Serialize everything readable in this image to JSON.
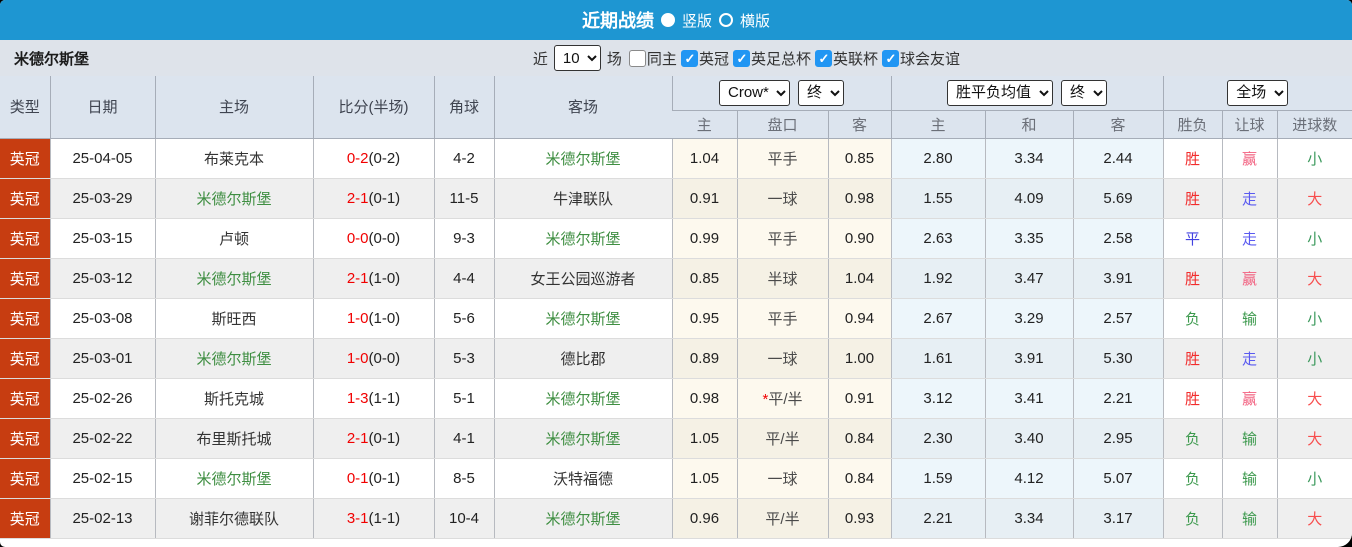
{
  "page": {
    "title": "近期战绩",
    "layout_options": [
      {
        "label": "竖版",
        "selected": true
      },
      {
        "label": "横版",
        "selected": false
      }
    ]
  },
  "filter": {
    "team": "米德尔斯堡",
    "recent_prefix": "近",
    "recent_count": "10",
    "recent_suffix": "场",
    "same_home_label": "同主",
    "same_home_checked": false,
    "competitions": [
      {
        "label": "英冠",
        "checked": true
      },
      {
        "label": "英足总杯",
        "checked": true
      },
      {
        "label": "英联杯",
        "checked": true
      },
      {
        "label": "球会友谊",
        "checked": true
      }
    ]
  },
  "header": {
    "odds_source_select": "Crow*",
    "odds_time_select": "终",
    "avg_type_select": "胜平负均值",
    "avg_time_select": "终",
    "scope_select": "全场"
  },
  "table": {
    "columns": [
      "类型",
      "日期",
      "主场",
      "比分(半场)",
      "角球",
      "客场"
    ],
    "sub_columns": [
      "主",
      "盘口",
      "客",
      "主",
      "和",
      "客",
      "胜负",
      "让球",
      "进球数"
    ],
    "rows": [
      {
        "league": "英冠",
        "date": "25-04-05",
        "home": "布莱克本",
        "score": "0-2",
        "half": "(0-2)",
        "corners": "4-2",
        "away": "米德尔斯堡",
        "odds_home": "1.04",
        "handicap": "平手",
        "star": false,
        "odds_away": "0.85",
        "avg_home": "2.80",
        "avg_draw": "3.34",
        "avg_away": "2.44",
        "result": "胜",
        "handicap_result": "赢",
        "goals": "小"
      },
      {
        "league": "英冠",
        "date": "25-03-29",
        "home": "米德尔斯堡",
        "score": "2-1",
        "half": "(0-1)",
        "corners": "11-5",
        "away": "牛津联队",
        "odds_home": "0.91",
        "handicap": "一球",
        "star": false,
        "odds_away": "0.98",
        "avg_home": "1.55",
        "avg_draw": "4.09",
        "avg_away": "5.69",
        "result": "胜",
        "handicap_result": "走",
        "goals": "大"
      },
      {
        "league": "英冠",
        "date": "25-03-15",
        "home": "卢顿",
        "score": "0-0",
        "half": "(0-0)",
        "corners": "9-3",
        "away": "米德尔斯堡",
        "odds_home": "0.99",
        "handicap": "平手",
        "star": false,
        "odds_away": "0.90",
        "avg_home": "2.63",
        "avg_draw": "3.35",
        "avg_away": "2.58",
        "result": "平",
        "handicap_result": "走",
        "goals": "小"
      },
      {
        "league": "英冠",
        "date": "25-03-12",
        "home": "米德尔斯堡",
        "score": "2-1",
        "half": "(1-0)",
        "corners": "4-4",
        "away": "女王公园巡游者",
        "odds_home": "0.85",
        "handicap": "半球",
        "star": false,
        "odds_away": "1.04",
        "avg_home": "1.92",
        "avg_draw": "3.47",
        "avg_away": "3.91",
        "result": "胜",
        "handicap_result": "赢",
        "goals": "大"
      },
      {
        "league": "英冠",
        "date": "25-03-08",
        "home": "斯旺西",
        "score": "1-0",
        "half": "(1-0)",
        "corners": "5-6",
        "away": "米德尔斯堡",
        "odds_home": "0.95",
        "handicap": "平手",
        "star": false,
        "odds_away": "0.94",
        "avg_home": "2.67",
        "avg_draw": "3.29",
        "avg_away": "2.57",
        "result": "负",
        "handicap_result": "输",
        "goals": "小"
      },
      {
        "league": "英冠",
        "date": "25-03-01",
        "home": "米德尔斯堡",
        "score": "1-0",
        "half": "(0-0)",
        "corners": "5-3",
        "away": "德比郡",
        "odds_home": "0.89",
        "handicap": "一球",
        "star": false,
        "odds_away": "1.00",
        "avg_home": "1.61",
        "avg_draw": "3.91",
        "avg_away": "5.30",
        "result": "胜",
        "handicap_result": "走",
        "goals": "小"
      },
      {
        "league": "英冠",
        "date": "25-02-26",
        "home": "斯托克城",
        "score": "1-3",
        "half": "(1-1)",
        "corners": "5-1",
        "away": "米德尔斯堡",
        "odds_home": "0.98",
        "handicap": "平/半",
        "star": true,
        "odds_away": "0.91",
        "avg_home": "3.12",
        "avg_draw": "3.41",
        "avg_away": "2.21",
        "result": "胜",
        "handicap_result": "赢",
        "goals": "大"
      },
      {
        "league": "英冠",
        "date": "25-02-22",
        "home": "布里斯托城",
        "score": "2-1",
        "half": "(0-1)",
        "corners": "4-1",
        "away": "米德尔斯堡",
        "odds_home": "1.05",
        "handicap": "平/半",
        "star": false,
        "odds_away": "0.84",
        "avg_home": "2.30",
        "avg_draw": "3.40",
        "avg_away": "2.95",
        "result": "负",
        "handicap_result": "输",
        "goals": "大"
      },
      {
        "league": "英冠",
        "date": "25-02-15",
        "home": "米德尔斯堡",
        "score": "0-1",
        "half": "(0-1)",
        "corners": "8-5",
        "away": "沃特福德",
        "odds_home": "1.05",
        "handicap": "一球",
        "star": false,
        "odds_away": "0.84",
        "avg_home": "1.59",
        "avg_draw": "4.12",
        "avg_away": "5.07",
        "result": "负",
        "handicap_result": "输",
        "goals": "小"
      },
      {
        "league": "英冠",
        "date": "25-02-13",
        "home": "谢菲尔德联队",
        "score": "3-1",
        "half": "(1-1)",
        "corners": "10-4",
        "away": "米德尔斯堡",
        "odds_home": "0.96",
        "handicap": "平/半",
        "star": false,
        "odds_away": "0.93",
        "avg_home": "2.21",
        "avg_draw": "3.34",
        "avg_away": "3.17",
        "result": "负",
        "handicap_result": "输",
        "goals": "大"
      }
    ]
  },
  "colors": {
    "title_bar": "#1e96d2",
    "filter_bar": "#dee3ea",
    "header_bg": "#dce4ee",
    "league_cell": "#c73d11",
    "highlight_team": "#3e8e41",
    "score_red": "#f10000",
    "win_red": "#f22c2c",
    "draw_blue": "#4242e0",
    "lose_green": "#3d9a4e",
    "handicap_win_pink": "#f2607f",
    "push_blue": "#5a5af0",
    "big_red": "#f74d4d",
    "small_green": "#3d9a5e",
    "odds_cell_bg": "#fdf9ee",
    "avg_cell_bg": "#edf6fb"
  }
}
